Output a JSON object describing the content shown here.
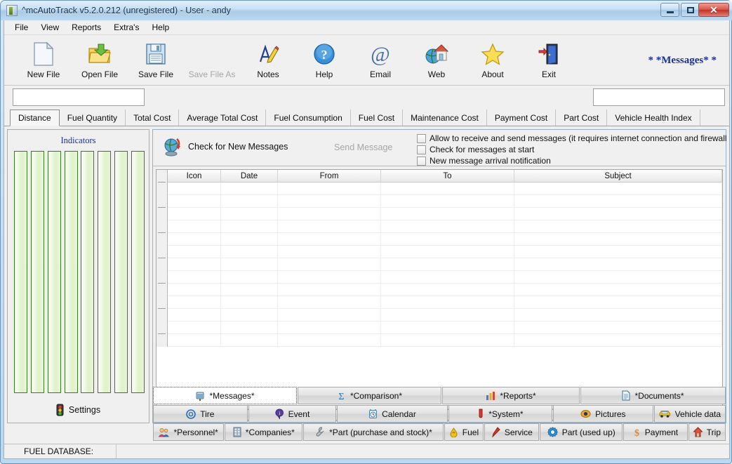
{
  "window": {
    "title": "^mcAutoTrack v5.2.0.212 (unregistered) - User - andy",
    "minimize_label": "",
    "maximize_label": "",
    "close_label": "✕"
  },
  "menu": {
    "items": [
      "File",
      "View",
      "Reports",
      "Extra's",
      "Help"
    ]
  },
  "toolbar": {
    "buttons": [
      {
        "label": "New File",
        "icon": "new-file-icon",
        "disabled": false
      },
      {
        "label": "Open File",
        "icon": "open-file-icon",
        "disabled": false
      },
      {
        "label": "Save File",
        "icon": "save-file-icon",
        "disabled": false
      },
      {
        "label": "Save File As",
        "icon": "save-file-as-icon",
        "disabled": true
      },
      {
        "label": "Notes",
        "icon": "notes-icon",
        "disabled": false
      },
      {
        "label": "Help",
        "icon": "help-icon",
        "disabled": false
      },
      {
        "label": "Email",
        "icon": "email-icon",
        "disabled": false
      },
      {
        "label": "Web",
        "icon": "web-icon",
        "disabled": false
      },
      {
        "label": "About",
        "icon": "about-star-icon",
        "disabled": false
      },
      {
        "label": "Exit",
        "icon": "exit-door-icon",
        "disabled": false
      }
    ],
    "messages_flag": "* *Messages* *",
    "messages_flag_color": "#1b2f9b"
  },
  "fields": {
    "left_value": "",
    "left_placeholder": "",
    "right_value": "",
    "right_placeholder": ""
  },
  "main_tabs": {
    "selected": "Distance",
    "items": [
      "Distance",
      "Fuel Quantity",
      "Total Cost",
      "Average Total Cost",
      "Fuel Consumption",
      "Fuel Cost",
      "Maintenance Cost",
      "Payment Cost",
      "Part Cost",
      "Vehicle Health Index"
    ]
  },
  "indicators": {
    "title": "Indicators",
    "bar_count": 8,
    "bar_fill": "#e3f3cf",
    "bar_border": "#3a7a1f",
    "settings_label": "Settings",
    "settings_icon": "traffic-light-icon"
  },
  "messages": {
    "check_button_label": "Check for New Messages",
    "check_button_icon": "globe-refresh-icon",
    "send_button_label": "Send Message",
    "options": [
      {
        "label": "Allow to receive and send messages (it requires internet connection and firewall permissi",
        "checked": false
      },
      {
        "label": "Check for messages at start",
        "checked": false
      },
      {
        "label": "New message arrival notification",
        "checked": false
      }
    ],
    "columns": [
      "Icon",
      "Date",
      "From",
      "To",
      "Subject"
    ],
    "rows": [],
    "row_count": 13,
    "scrollbar_grip": "|||"
  },
  "bottom_tabs": {
    "selected": "*Messages*",
    "row1": [
      {
        "label": "*Messages*",
        "icon": "mailbox-icon"
      },
      {
        "label": "*Comparison*",
        "icon": "sigma-icon"
      },
      {
        "label": "*Reports*",
        "icon": "bar-chart-icon"
      },
      {
        "label": "*Documents*",
        "icon": "document-icon"
      }
    ],
    "row2": [
      {
        "label": "Tire",
        "icon": "tire-icon"
      },
      {
        "label": "Event",
        "icon": "info-balloon-icon"
      },
      {
        "label": "Calendar",
        "icon": "calendar-clock-icon"
      },
      {
        "label": "*System*",
        "icon": "system-icon"
      },
      {
        "label": "Pictures",
        "icon": "eye-icon"
      },
      {
        "label": "Vehicle data",
        "icon": "car-icon"
      }
    ],
    "row3": [
      {
        "label": "*Personnel*",
        "icon": "people-icon"
      },
      {
        "label": "*Companies*",
        "icon": "building-icon"
      },
      {
        "label": "*Part (purchase and stock)*",
        "icon": "wrench-icon"
      },
      {
        "label": "Fuel",
        "icon": "fuel-drop-icon"
      },
      {
        "label": "Service",
        "icon": "screwdriver-icon"
      },
      {
        "label": "Part (used up)",
        "icon": "gear-icon"
      },
      {
        "label": "Payment",
        "icon": "dollar-icon"
      },
      {
        "label": "Trip",
        "icon": "house-icon"
      }
    ]
  },
  "status": {
    "label": "FUEL DATABASE:",
    "value": ""
  }
}
